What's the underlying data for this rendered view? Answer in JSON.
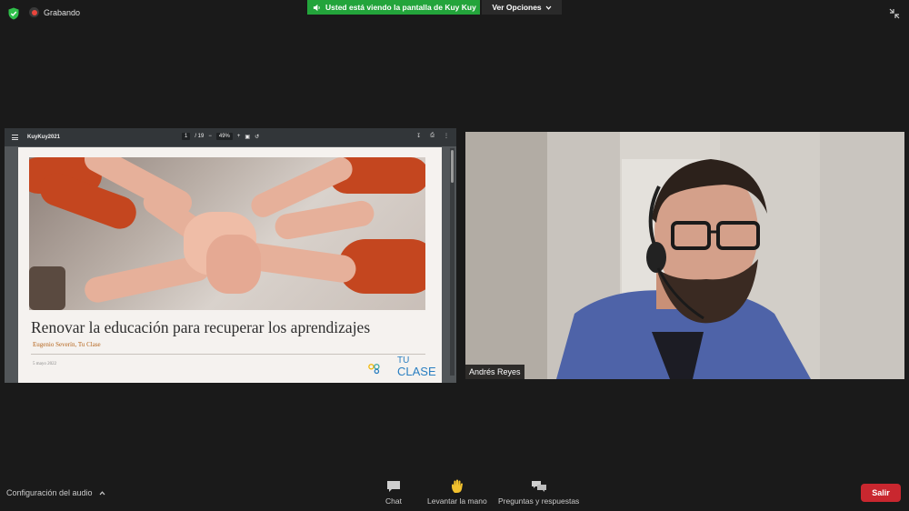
{
  "top_bar": {
    "recording_label": "Grabando",
    "share_banner": "Usted está viendo la pantalla de Kuy Kuy",
    "view_options": "Ver Opciones"
  },
  "pdf_viewer": {
    "doc_title": "KuyKuy2021",
    "page_current": "1",
    "page_total": "/ 19",
    "zoom": "49%"
  },
  "slide": {
    "title": "Renovar la educación para recuperar los aprendizajes",
    "author": "Eugenio Severín, Tu Clase",
    "date": "5 mayo 2022",
    "logo_line1": "TU",
    "logo_line2": "CLASE"
  },
  "participant": {
    "name": "Andrés Reyes"
  },
  "toolbar": {
    "audio_settings": "Configuración del audio",
    "chat": "Chat",
    "raise_hand": "Levantar la mano",
    "qa": "Preguntas y respuestas",
    "leave": "Salir"
  },
  "colors": {
    "share_green": "#23a43b",
    "leave_red": "#c9272f",
    "background": "#1a1a1a"
  }
}
